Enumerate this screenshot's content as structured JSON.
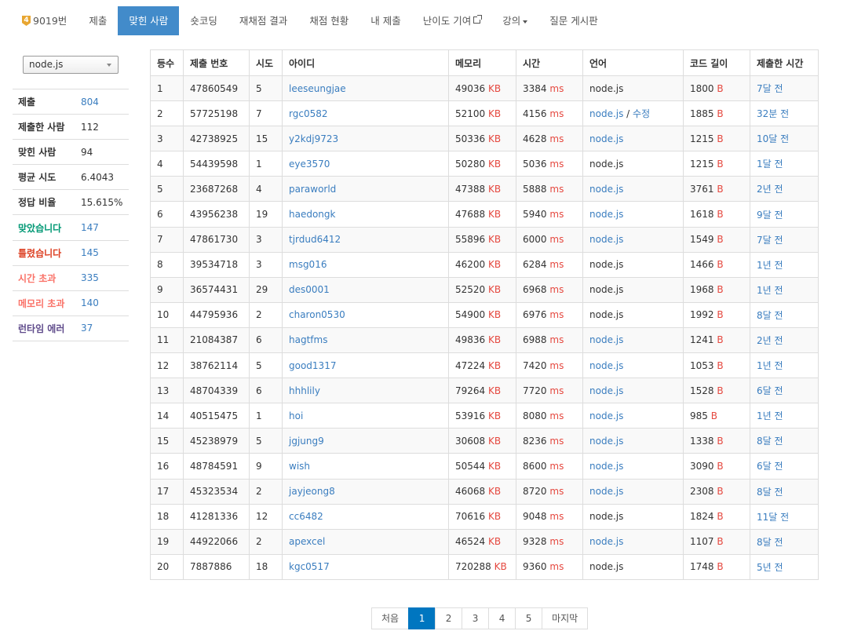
{
  "nav": {
    "problem_number": "9019번",
    "tier_badge": "4",
    "items": [
      {
        "label": "제출",
        "name": "nav-submit"
      },
      {
        "label": "맞힌 사람",
        "name": "nav-solved",
        "active": true
      },
      {
        "label": "숏코딩",
        "name": "nav-shortcoding"
      },
      {
        "label": "재채점 결과",
        "name": "nav-rejudge-result"
      },
      {
        "label": "채점 현황",
        "name": "nav-status"
      },
      {
        "label": "내 제출",
        "name": "nav-my-submissions"
      },
      {
        "label": "난이도 기여",
        "name": "nav-difficulty-contribution",
        "external": true
      },
      {
        "label": "강의",
        "name": "nav-lectures",
        "dropdown": true
      },
      {
        "label": "질문 게시판",
        "name": "nav-qna-board"
      }
    ]
  },
  "language_filter": {
    "selected": "node.js"
  },
  "stats": [
    {
      "label": "제출",
      "value": "804",
      "label_color": "#333333",
      "value_color": "#3a7dbf"
    },
    {
      "label": "제출한 사람",
      "value": "112",
      "label_color": "#333333",
      "value_color": "#333333"
    },
    {
      "label": "맞힌 사람",
      "value": "94",
      "label_color": "#333333",
      "value_color": "#333333"
    },
    {
      "label": "평균 시도",
      "value": "6.4043",
      "label_color": "#333333",
      "value_color": "#333333"
    },
    {
      "label": "정답 비율",
      "value": "15.615%",
      "label_color": "#333333",
      "value_color": "#333333"
    },
    {
      "label": "맞았습니다",
      "value": "147",
      "label_color": "#009874",
      "value_color": "#3a7dbf"
    },
    {
      "label": "틀렸습니다",
      "value": "145",
      "label_color": "#dd4124",
      "value_color": "#3a7dbf"
    },
    {
      "label": "시간 초과",
      "value": "335",
      "label_color": "#fa7268",
      "value_color": "#3a7dbf"
    },
    {
      "label": "메모리 초과",
      "value": "140",
      "label_color": "#fa7268",
      "value_color": "#3a7dbf"
    },
    {
      "label": "런타임 에러",
      "value": "37",
      "label_color": "#5f4b8b",
      "value_color": "#3a7dbf"
    }
  ],
  "table": {
    "headers": [
      "등수",
      "제출 번호",
      "시도",
      "아이디",
      "메모리",
      "시간",
      "언어",
      "코드 길이",
      "제출한 시간"
    ],
    "units": {
      "memory": "KB",
      "time": "ms",
      "code": "B"
    },
    "rows": [
      {
        "rank": "1",
        "submission_id": "47860549",
        "attempts": "5",
        "user": "leeseungjae",
        "memory": "49036",
        "time": "3384",
        "language": "node.js",
        "language_link": false,
        "edit_label": "",
        "code_length": "1800",
        "submitted": "7달 전"
      },
      {
        "rank": "2",
        "submission_id": "57725198",
        "attempts": "7",
        "user": "rgc0582",
        "memory": "52100",
        "time": "4156",
        "language": "node.js",
        "language_link": true,
        "edit_label": "수정",
        "code_length": "1885",
        "submitted": "32분 전"
      },
      {
        "rank": "3",
        "submission_id": "42738925",
        "attempts": "15",
        "user": "y2kdj9723",
        "memory": "50336",
        "time": "4628",
        "language": "node.js",
        "language_link": true,
        "edit_label": "",
        "code_length": "1215",
        "submitted": "10달 전"
      },
      {
        "rank": "4",
        "submission_id": "54439598",
        "attempts": "1",
        "user": "eye3570",
        "memory": "50280",
        "time": "5036",
        "language": "node.js",
        "language_link": false,
        "edit_label": "",
        "code_length": "1215",
        "submitted": "1달 전"
      },
      {
        "rank": "5",
        "submission_id": "23687268",
        "attempts": "4",
        "user": "paraworld",
        "memory": "47388",
        "time": "5888",
        "language": "node.js",
        "language_link": true,
        "edit_label": "",
        "code_length": "3761",
        "submitted": "2년 전"
      },
      {
        "rank": "6",
        "submission_id": "43956238",
        "attempts": "19",
        "user": "haedongk",
        "memory": "47688",
        "time": "5940",
        "language": "node.js",
        "language_link": true,
        "edit_label": "",
        "code_length": "1618",
        "submitted": "9달 전"
      },
      {
        "rank": "7",
        "submission_id": "47861730",
        "attempts": "3",
        "user": "tjrdud6412",
        "memory": "55896",
        "time": "6000",
        "language": "node.js",
        "language_link": true,
        "edit_label": "",
        "code_length": "1549",
        "submitted": "7달 전"
      },
      {
        "rank": "8",
        "submission_id": "39534718",
        "attempts": "3",
        "user": "msg016",
        "memory": "46200",
        "time": "6284",
        "language": "node.js",
        "language_link": false,
        "edit_label": "",
        "code_length": "1466",
        "submitted": "1년 전"
      },
      {
        "rank": "9",
        "submission_id": "36574431",
        "attempts": "29",
        "user": "des0001",
        "memory": "52520",
        "time": "6968",
        "language": "node.js",
        "language_link": false,
        "edit_label": "",
        "code_length": "1968",
        "submitted": "1년 전"
      },
      {
        "rank": "10",
        "submission_id": "44795936",
        "attempts": "2",
        "user": "charon0530",
        "memory": "54900",
        "time": "6976",
        "language": "node.js",
        "language_link": false,
        "edit_label": "",
        "code_length": "1992",
        "submitted": "8달 전"
      },
      {
        "rank": "11",
        "submission_id": "21084387",
        "attempts": "6",
        "user": "hagtfms",
        "memory": "49836",
        "time": "6988",
        "language": "node.js",
        "language_link": true,
        "edit_label": "",
        "code_length": "1241",
        "submitted": "2년 전"
      },
      {
        "rank": "12",
        "submission_id": "38762114",
        "attempts": "5",
        "user": "good1317",
        "memory": "47224",
        "time": "7420",
        "language": "node.js",
        "language_link": true,
        "edit_label": "",
        "code_length": "1053",
        "submitted": "1년 전"
      },
      {
        "rank": "13",
        "submission_id": "48704339",
        "attempts": "6",
        "user": "hhhlily",
        "memory": "79264",
        "time": "7720",
        "language": "node.js",
        "language_link": true,
        "edit_label": "",
        "code_length": "1528",
        "submitted": "6달 전"
      },
      {
        "rank": "14",
        "submission_id": "40515475",
        "attempts": "1",
        "user": "hoi",
        "memory": "53916",
        "time": "8080",
        "language": "node.js",
        "language_link": true,
        "edit_label": "",
        "code_length": "985",
        "submitted": "1년 전"
      },
      {
        "rank": "15",
        "submission_id": "45238979",
        "attempts": "5",
        "user": "jgjung9",
        "memory": "30608",
        "time": "8236",
        "language": "node.js",
        "language_link": true,
        "edit_label": "",
        "code_length": "1338",
        "submitted": "8달 전"
      },
      {
        "rank": "16",
        "submission_id": "48784591",
        "attempts": "9",
        "user": "wish",
        "memory": "50544",
        "time": "8600",
        "language": "node.js",
        "language_link": true,
        "edit_label": "",
        "code_length": "3090",
        "submitted": "6달 전"
      },
      {
        "rank": "17",
        "submission_id": "45323534",
        "attempts": "2",
        "user": "jayjeong8",
        "memory": "46068",
        "time": "8720",
        "language": "node.js",
        "language_link": true,
        "edit_label": "",
        "code_length": "2308",
        "submitted": "8달 전"
      },
      {
        "rank": "18",
        "submission_id": "41281336",
        "attempts": "12",
        "user": "cc6482",
        "memory": "70616",
        "time": "9048",
        "language": "node.js",
        "language_link": false,
        "edit_label": "",
        "code_length": "1824",
        "submitted": "11달 전"
      },
      {
        "rank": "19",
        "submission_id": "44922066",
        "attempts": "2",
        "user": "apexcel",
        "memory": "46524",
        "time": "9328",
        "language": "node.js",
        "language_link": true,
        "edit_label": "",
        "code_length": "1107",
        "submitted": "8달 전"
      },
      {
        "rank": "20",
        "submission_id": "7887886",
        "attempts": "18",
        "user": "kgc0517",
        "memory": "720288",
        "time": "9360",
        "language": "node.js",
        "language_link": false,
        "edit_label": "",
        "code_length": "1748",
        "submitted": "5년 전"
      }
    ]
  },
  "pagination": {
    "first_label": "처음",
    "pages": [
      "1",
      "2",
      "3",
      "4",
      "5"
    ],
    "active_page": "1",
    "last_label": "마지막"
  },
  "colors": {
    "link": "#3a7dbf",
    "unit": "#e5483f",
    "nav_active": "#428bca",
    "page_active": "#0076c0",
    "tier_badge": "#e8a631"
  }
}
